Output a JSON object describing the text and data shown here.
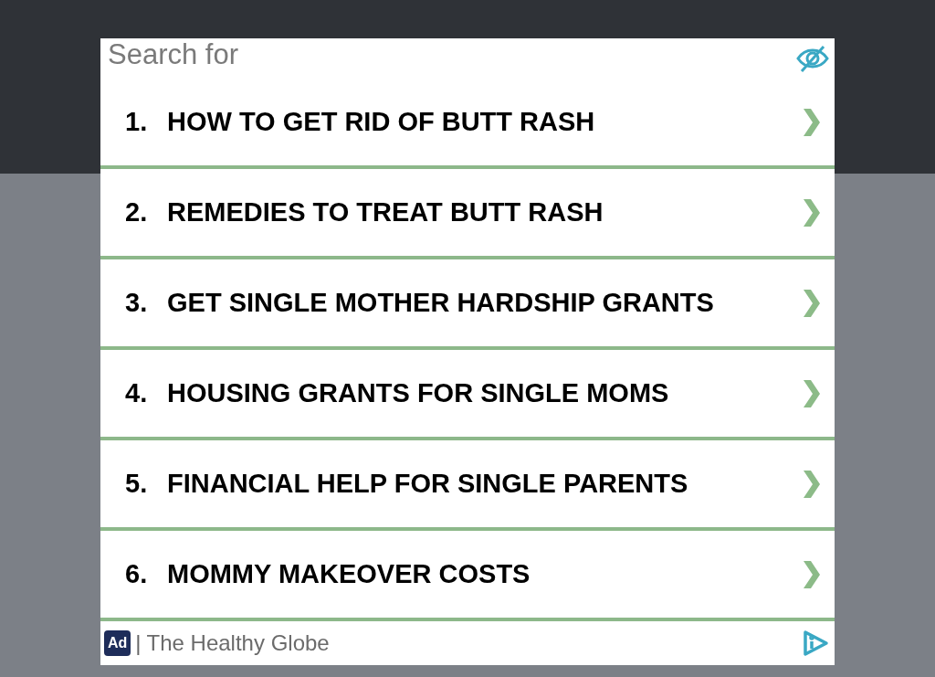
{
  "header": {
    "title": "Search for"
  },
  "results": [
    {
      "number": "1.",
      "label": "HOW TO GET RID OF BUTT RASH"
    },
    {
      "number": "2.",
      "label": "REMEDIES TO TREAT BUTT RASH"
    },
    {
      "number": "3.",
      "label": "GET SINGLE MOTHER HARDSHIP GRANTS"
    },
    {
      "number": "4.",
      "label": "HOUSING GRANTS FOR SINGLE MOMS"
    },
    {
      "number": "5.",
      "label": "FINANCIAL HELP FOR SINGLE PARENTS"
    },
    {
      "number": "6.",
      "label": "MOMMY MAKEOVER COSTS"
    }
  ],
  "footer": {
    "badge": "Ad",
    "separator": "|",
    "source": "The Healthy Globe"
  }
}
